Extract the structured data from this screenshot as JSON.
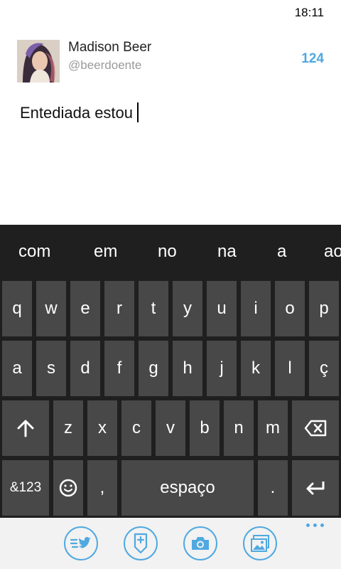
{
  "status": {
    "time": "18:11"
  },
  "compose": {
    "display_name": "Madison Beer",
    "handle": "@beerdoente",
    "char_count": "124",
    "tweet_text": "Entediada estou"
  },
  "keyboard": {
    "suggestions": [
      "com",
      "em",
      "no",
      "na",
      "a",
      "ao"
    ],
    "row1": [
      "q",
      "w",
      "e",
      "r",
      "t",
      "y",
      "u",
      "i",
      "o",
      "p"
    ],
    "row2": [
      "a",
      "s",
      "d",
      "f",
      "g",
      "h",
      "j",
      "k",
      "l",
      "ç"
    ],
    "row3": [
      "z",
      "x",
      "c",
      "v",
      "b",
      "n",
      "m"
    ],
    "symbols_label": "&123",
    "comma_label": ",",
    "space_label": "espaço",
    "period_label": "."
  },
  "app_bar": {
    "buttons": [
      "compose-tweet-icon",
      "add-location-icon",
      "camera-icon",
      "gallery-icon"
    ],
    "accent_color": "#4fa9e0"
  }
}
